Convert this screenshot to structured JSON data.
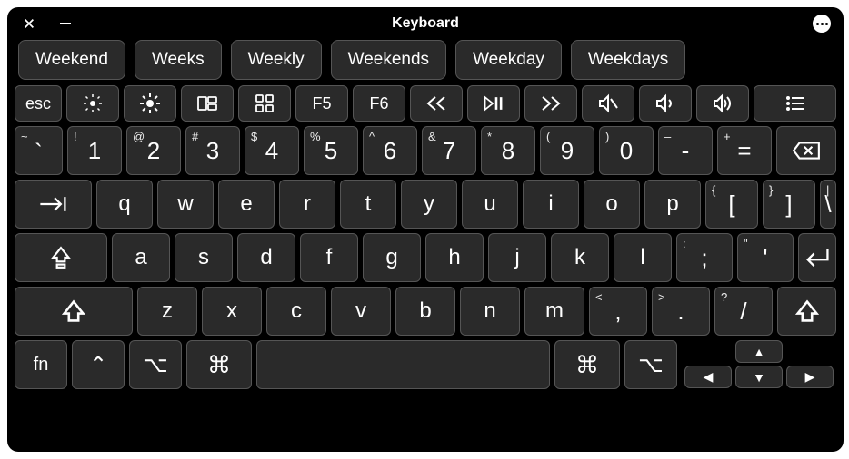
{
  "title": "Keyboard",
  "suggestions": [
    "Weekend",
    "Weeks",
    "Weekly",
    "Weekends",
    "Weekday",
    "Weekdays"
  ],
  "fn_row": {
    "esc": "esc",
    "f5": "F5",
    "f6": "F6"
  },
  "num_row": [
    {
      "sub": "~",
      "main": "`"
    },
    {
      "sub": "!",
      "main": "1"
    },
    {
      "sub": "@",
      "main": "2"
    },
    {
      "sub": "#",
      "main": "3"
    },
    {
      "sub": "$",
      "main": "4"
    },
    {
      "sub": "%",
      "main": "5"
    },
    {
      "sub": "^",
      "main": "6"
    },
    {
      "sub": "&",
      "main": "7"
    },
    {
      "sub": "*",
      "main": "8"
    },
    {
      "sub": "(",
      "main": "9"
    },
    {
      "sub": ")",
      "main": "0"
    },
    {
      "sub": "–",
      "main": "-"
    },
    {
      "sub": "+",
      "main": "="
    }
  ],
  "row_q": [
    "q",
    "w",
    "e",
    "r",
    "t",
    "y",
    "u",
    "i",
    "o",
    "p"
  ],
  "row_q_tail": [
    {
      "sub": "{",
      "main": "["
    },
    {
      "sub": "}",
      "main": "]"
    },
    {
      "sub": "|",
      "main": "\\"
    }
  ],
  "row_a": [
    "a",
    "s",
    "d",
    "f",
    "g",
    "h",
    "j",
    "k",
    "l"
  ],
  "row_a_tail": [
    {
      "sub": ":",
      "main": ";"
    },
    {
      "sub": "\"",
      "main": "'"
    }
  ],
  "row_z": [
    "z",
    "x",
    "c",
    "v",
    "b",
    "n",
    "m"
  ],
  "row_z_tail": [
    {
      "sub": "<",
      "main": ","
    },
    {
      "sub": ">",
      "main": "."
    },
    {
      "sub": "?",
      "main": "/"
    }
  ],
  "bottom": {
    "fn": "fn",
    "ctrl": "⌃",
    "opt": "⌥",
    "cmd": "⌘",
    "cmd2": "⌘",
    "opt2": "⌥"
  },
  "arrows": {
    "up": "▲",
    "down": "▼",
    "left": "◀",
    "right": "▶"
  }
}
